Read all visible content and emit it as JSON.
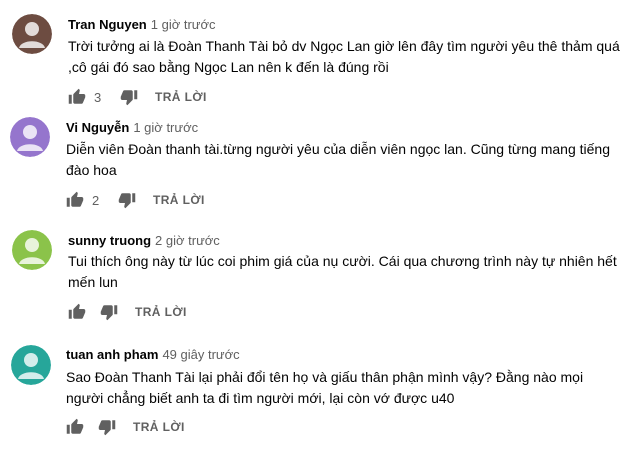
{
  "comments": [
    {
      "author": "Tran Nguyen",
      "time": "1 giờ trước",
      "avatar_color": "#6d4c41",
      "avatar_icon": "person-icon",
      "lines": [
        "Trời tưởng ai là Đoàn Thanh Tài bỏ dv Ngọc Lan giờ lên đây tìm người yêu thê thảm quá",
        ",cô gái đó sao bằng Ngọc Lan nên k đến là đúng rồi"
      ],
      "likes": "3",
      "reply_label": "TRẢ LỜI"
    },
    {
      "author": "Vi Nguyễn",
      "time": "1 giờ trước",
      "avatar_color": "#9575cd",
      "avatar_icon": "person-icon",
      "lines": [
        "Diễn viên Đoàn thanh tài.từng người yêu của diễn viên ngọc lan. Cũng từng mang tiếng",
        "đào hoa"
      ],
      "likes": "2",
      "reply_label": "TRẢ LỜI"
    },
    {
      "author": "sunny truong",
      "time": "2 giờ trước",
      "avatar_color": "#8bc34a",
      "avatar_icon": "person-icon",
      "lines": [
        "Tui thích ông này từ lúc coi phim giá của nụ cười. Cái qua chương trình này tự nhiên hết",
        "mến lun"
      ],
      "likes": "",
      "reply_label": "TRẢ LỜI"
    },
    {
      "author": "tuan anh pham",
      "time": "49 giây trước",
      "avatar_color": "#26a69a",
      "avatar_icon": "person-icon",
      "lines": [
        "Sao Đoàn Thanh Tài lại phải đổi tên họ và giấu thân phận mình vậy? Đằng nào mọi",
        "người chẳng biết anh ta đi tìm người mới, lại còn vớ được u40"
      ],
      "likes": "",
      "reply_label": "TRẢ LỜI"
    }
  ],
  "icons": {
    "like": "thumb-up-icon",
    "dislike": "thumb-down-icon"
  }
}
